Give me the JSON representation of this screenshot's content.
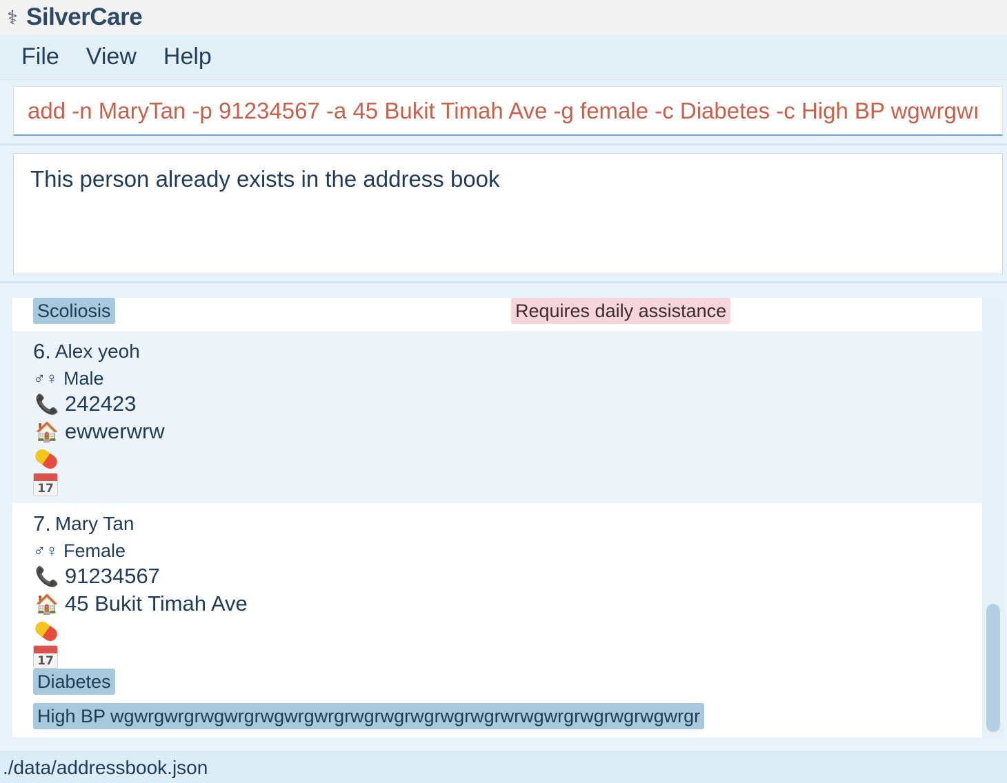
{
  "window": {
    "title": "SilverCare",
    "icon": "caduceus-icon"
  },
  "menu": {
    "items": [
      "File",
      "View",
      "Help"
    ]
  },
  "command": {
    "value": "add -n MaryTan -p 91234567 -a 45 Bukit Timah Ave -g female -c Diabetes -c High BP wgwrgwı"
  },
  "result": {
    "message": "This person already exists in the address book"
  },
  "list": {
    "partial_card": {
      "condition": "Scoliosis",
      "note": "Requires daily assistance"
    },
    "persons": [
      {
        "index": "6.",
        "name": "Alex yeoh",
        "gender": "Male",
        "phone": "242423",
        "address": "ewwerwrw",
        "conditions": []
      },
      {
        "index": "7.",
        "name": "Mary Tan",
        "gender": "Female",
        "phone": "91234567",
        "address": "45 Bukit Timah Ave",
        "conditions": [
          "Diabetes",
          "High BP wgwrgwrgrwgwrgrwgwrgwrgrwgrwgrwgrwgrwgrwrwgwrgrwgrwgrwgwrgr"
        ]
      }
    ],
    "icons": {
      "gender": "♂♀",
      "phone": "📞",
      "address": "🏠",
      "medication": "pill-icon",
      "calendar_day": "17"
    }
  },
  "status": {
    "path": "./data/addressbook.json"
  }
}
